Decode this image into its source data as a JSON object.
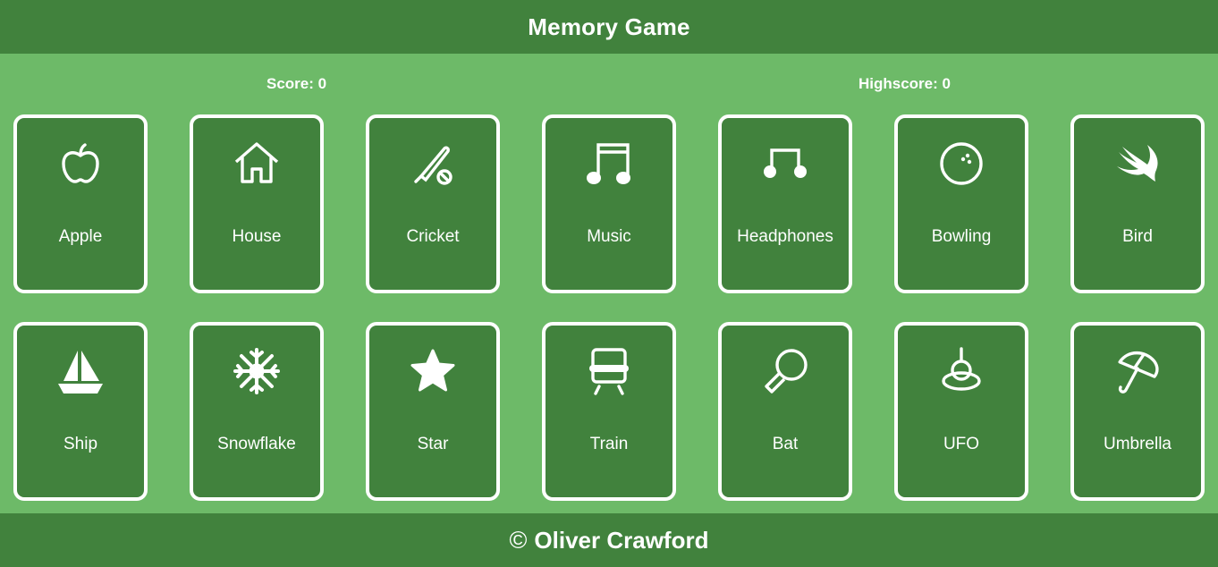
{
  "header": {
    "title": "Memory Game"
  },
  "scores": {
    "score_label": "Score: 0",
    "highscore_label": "Highscore: 0"
  },
  "cards": [
    {
      "label": "Apple",
      "icon": "apple-icon"
    },
    {
      "label": "House",
      "icon": "house-icon"
    },
    {
      "label": "Cricket",
      "icon": "cricket-icon"
    },
    {
      "label": "Music",
      "icon": "music-icon"
    },
    {
      "label": "Headphones",
      "icon": "headphones-icon"
    },
    {
      "label": "Bowling",
      "icon": "bowling-icon"
    },
    {
      "label": "Bird",
      "icon": "bird-icon"
    },
    {
      "label": "Ship",
      "icon": "ship-icon"
    },
    {
      "label": "Snowflake",
      "icon": "snowflake-icon"
    },
    {
      "label": "Star",
      "icon": "star-icon"
    },
    {
      "label": "Train",
      "icon": "train-icon"
    },
    {
      "label": "Bat",
      "icon": "bat-icon"
    },
    {
      "label": "UFO",
      "icon": "ufo-icon"
    },
    {
      "label": "Umbrella",
      "icon": "umbrella-icon"
    }
  ],
  "footer": {
    "copyright_symbol": "©",
    "author": "Oliver Crawford"
  },
  "colors": {
    "background": "#6dba68",
    "bar": "#41823d",
    "card": "#41823d",
    "border": "#ffffff"
  }
}
